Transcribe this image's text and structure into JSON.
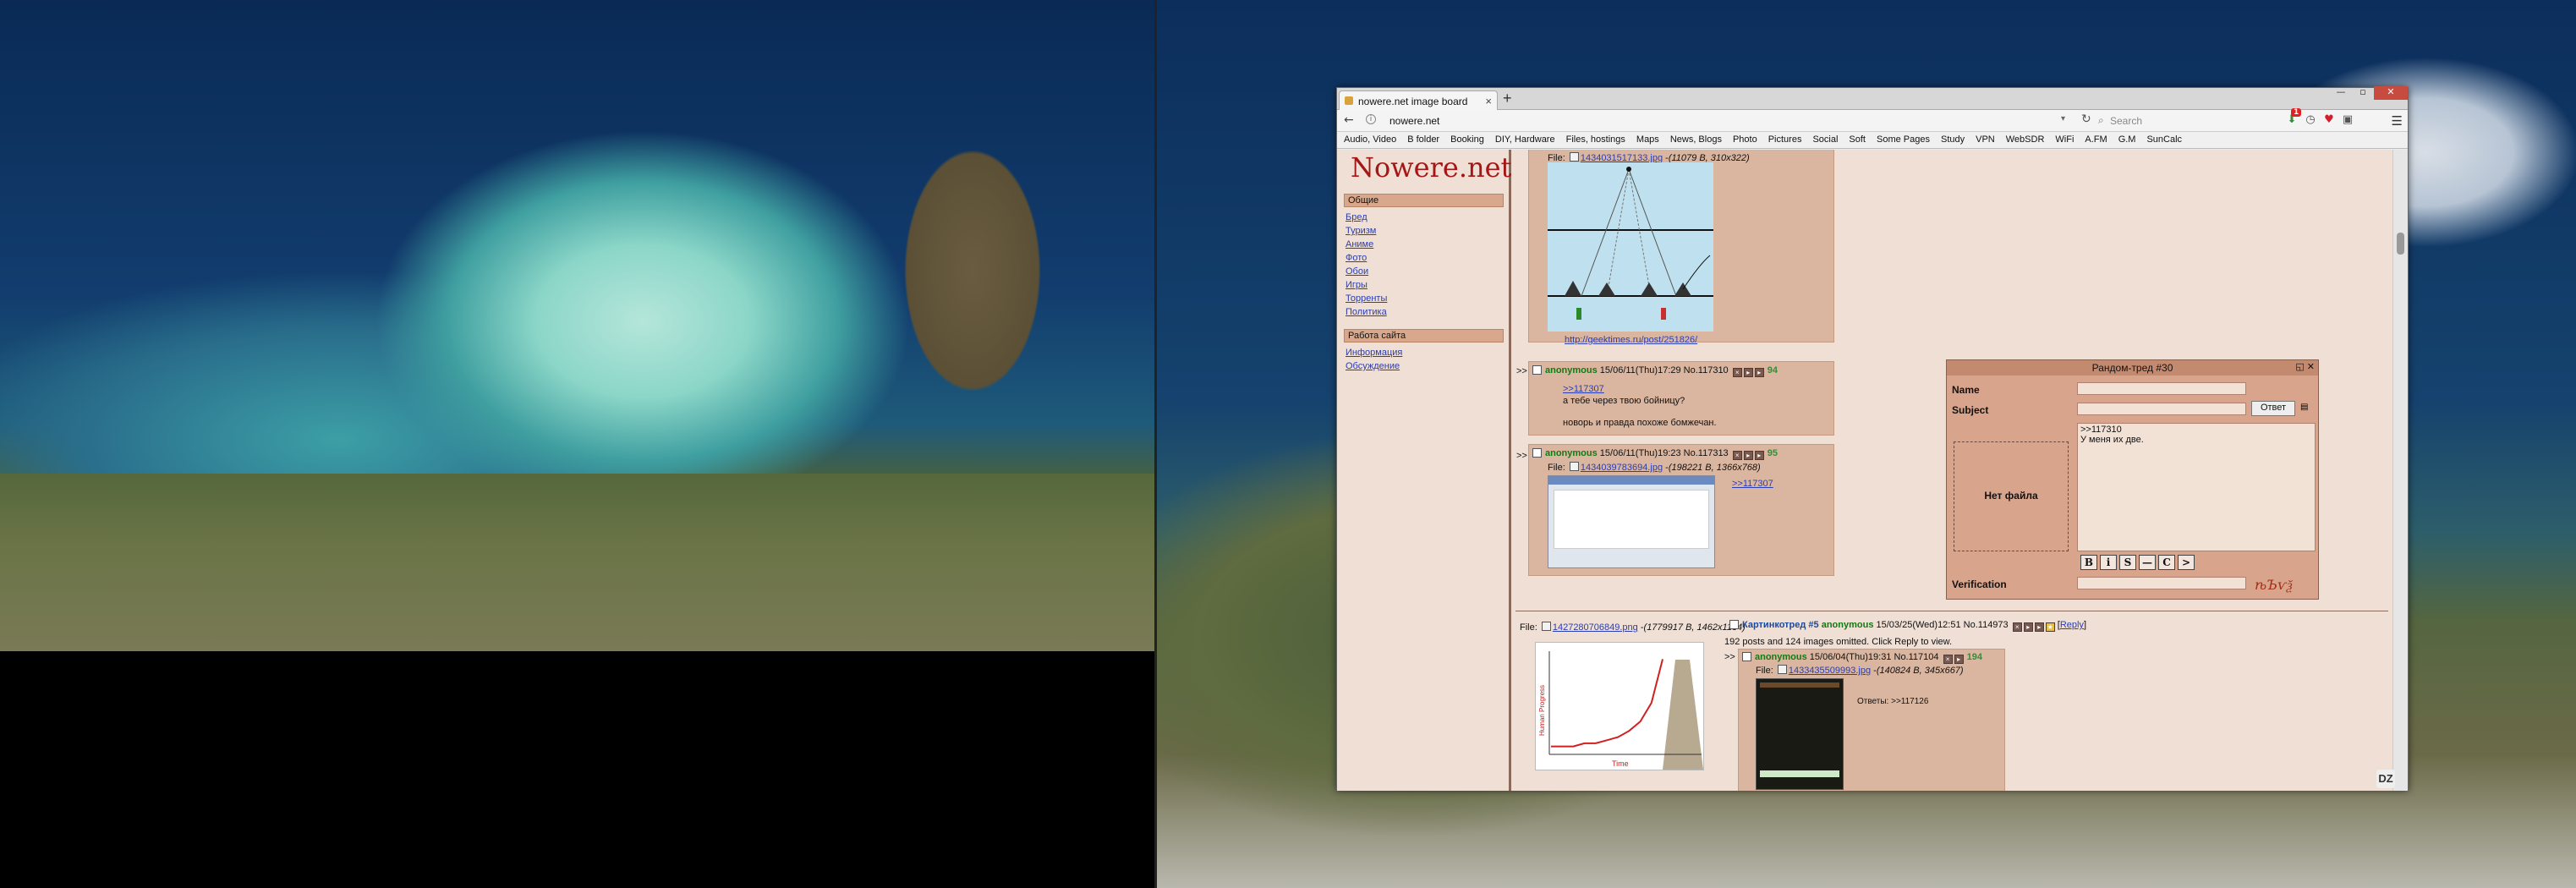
{
  "browser": {
    "tab_title": "nowere.net image board",
    "url": "nowere.net",
    "search_placeholder": "Search",
    "badge_count": "1",
    "bookmarks": [
      "Audio, Video",
      "B folder",
      "Booking",
      "DIY, Hardware",
      "Files, hostings",
      "Maps",
      "News, Blogs",
      "Photo",
      "Pictures",
      "Social",
      "Soft",
      "Some Pages",
      "Study",
      "VPN",
      "WebSDR",
      "WiFi",
      "A.FM",
      "G.M",
      "SunCalc"
    ]
  },
  "sidebar": {
    "logo": "Nowere.net",
    "section1": "Общие",
    "links1": [
      "Бред",
      "Туризм",
      "Аниме",
      "Фото",
      "Обои",
      "Игры",
      "Торренты",
      "Политика"
    ],
    "section2": "Работа сайта",
    "links2": [
      "Информация",
      "Обсуждение"
    ]
  },
  "posts": {
    "top_file": {
      "label": "File:",
      "name": "1434031517133.jpg",
      "meta": "(11079 B, 310x322)"
    },
    "top_link": "http://geektimes.ru/post/251826/",
    "p1": {
      "name": "anonymous",
      "date": "15/06/11(Thu)17:29",
      "no": "No.117310",
      "num": "94",
      "ref": ">>117307",
      "line1": "а тебе через твою бойницу?",
      "line2": "новорь и правда похоже бомжечан."
    },
    "p2": {
      "name": "anonymous",
      "date": "15/06/11(Thu)19:23",
      "no": "No.117313",
      "num": "95",
      "file": "1434039783694.jpg",
      "meta": "(198221 B, 1366x768)",
      "ref": ">>117307"
    },
    "thread": {
      "file": "1427280706849.png",
      "meta": "(1779917 B, 1462x1134)",
      "title": "Картинкотред #5",
      "name": "anonymous",
      "date": "15/03/25(Wed)12:51",
      "no": "No.114973",
      "reply": "Reply",
      "omitted": "192 posts and 124 images omitted. Click Reply to view."
    },
    "p3": {
      "name": "anonymous",
      "date": "15/06/04(Thu)19:31",
      "no": "No.117104",
      "num": "194",
      "file": "1433435509993.jpg",
      "meta": "(140824 B, 345x667)",
      "answers": "Ответы: >>117126"
    }
  },
  "chart_data": {
    "type": "line",
    "xlabel": "Time",
    "ylabel": "Human Progress",
    "x": [
      0,
      1,
      2,
      3,
      4,
      5,
      6,
      7,
      8,
      9,
      10
    ],
    "values": [
      2,
      2,
      2,
      3,
      3,
      4,
      5,
      7,
      10,
      16,
      30
    ],
    "ylim": [
      0,
      32
    ]
  },
  "panel": {
    "title": "Рандом-тред #30",
    "name_label": "Name",
    "subject_label": "Subject",
    "submit": "Ответ",
    "message": ">>117310\nУ меня их две.",
    "nofile": "Нет файла",
    "verification_label": "Verification",
    "fmt": [
      "B",
      "i",
      "S",
      "—",
      "C",
      ">"
    ],
    "captcha": "ѣЪѵѯ"
  }
}
